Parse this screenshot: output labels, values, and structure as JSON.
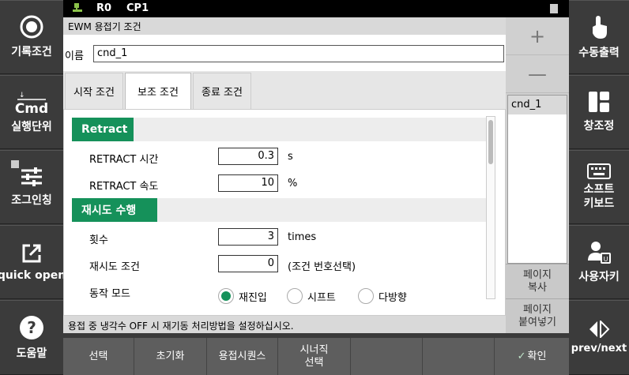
{
  "left_panel": {
    "items": [
      {
        "label": "기록조건",
        "icon": "record-icon"
      },
      {
        "label": "Cmd",
        "sublabel": "실행단위",
        "icon": "cmd-icon"
      },
      {
        "label": "조그인칭",
        "icon": "jog-sliders-icon"
      },
      {
        "label": "quick open",
        "icon": "open-external-icon"
      },
      {
        "label": "도움말",
        "icon": "help-icon"
      }
    ]
  },
  "right_panel": {
    "items": [
      {
        "label": "수동출력",
        "icon": "touch-hand-icon"
      },
      {
        "label": "창조정",
        "icon": "window-layout-icon"
      },
      {
        "label": "소프트 키보드",
        "label_line1": "소프트",
        "label_line2": "키보드",
        "icon": "keyboard-icon"
      },
      {
        "label": "사용자키",
        "icon": "user-key-icon"
      },
      {
        "label": "prev/next",
        "icon": "prev-next-icon"
      }
    ]
  },
  "topbar": {
    "robot_id": "R0",
    "cp": "CP1"
  },
  "dialog": {
    "title": "EWM 용접기 조건",
    "name_label": "이름",
    "name_value": "cnd_1",
    "tabs": [
      "시작 조건",
      "보조 조건",
      "종료 조건"
    ],
    "active_tab": "보조 조건",
    "sections": {
      "retract": {
        "title": "Retract",
        "rows": [
          {
            "label": "RETRACT 시간",
            "value": "0.3",
            "unit": "s"
          },
          {
            "label": "RETRACT 속도",
            "value": "10",
            "unit": "%"
          }
        ]
      },
      "retry": {
        "title": "재시도 수행",
        "rows": [
          {
            "label": "횟수",
            "value": "3",
            "unit": "times"
          },
          {
            "label": "재시도 조건",
            "value": "0",
            "unit": "(조건 번호선택)"
          }
        ],
        "mode_label": "동작 모드",
        "mode_options": [
          "재진입",
          "시프트",
          "다방향"
        ],
        "mode_selected": "재진입"
      }
    },
    "status_text": "용접 중 냉각수 OFF 시 재기동 처리방법을 설정하십시오."
  },
  "list_column": {
    "plus": "+",
    "minus": "—",
    "items": [
      "cnd_1"
    ],
    "page_copy": {
      "line1": "페이지",
      "line2": "복사"
    },
    "page_paste": {
      "line1": "페이지",
      "line2": "붙여넣기"
    }
  },
  "function_keys": {
    "f1": "선택",
    "f2": "초기화",
    "f3": "용접시퀀스",
    "f4_line1": "시너직",
    "f4_line2": "선택",
    "f5": "",
    "f6": "",
    "f7": "확인"
  },
  "colors": {
    "accent": "#15915a",
    "panel": "#3b3b3b"
  }
}
